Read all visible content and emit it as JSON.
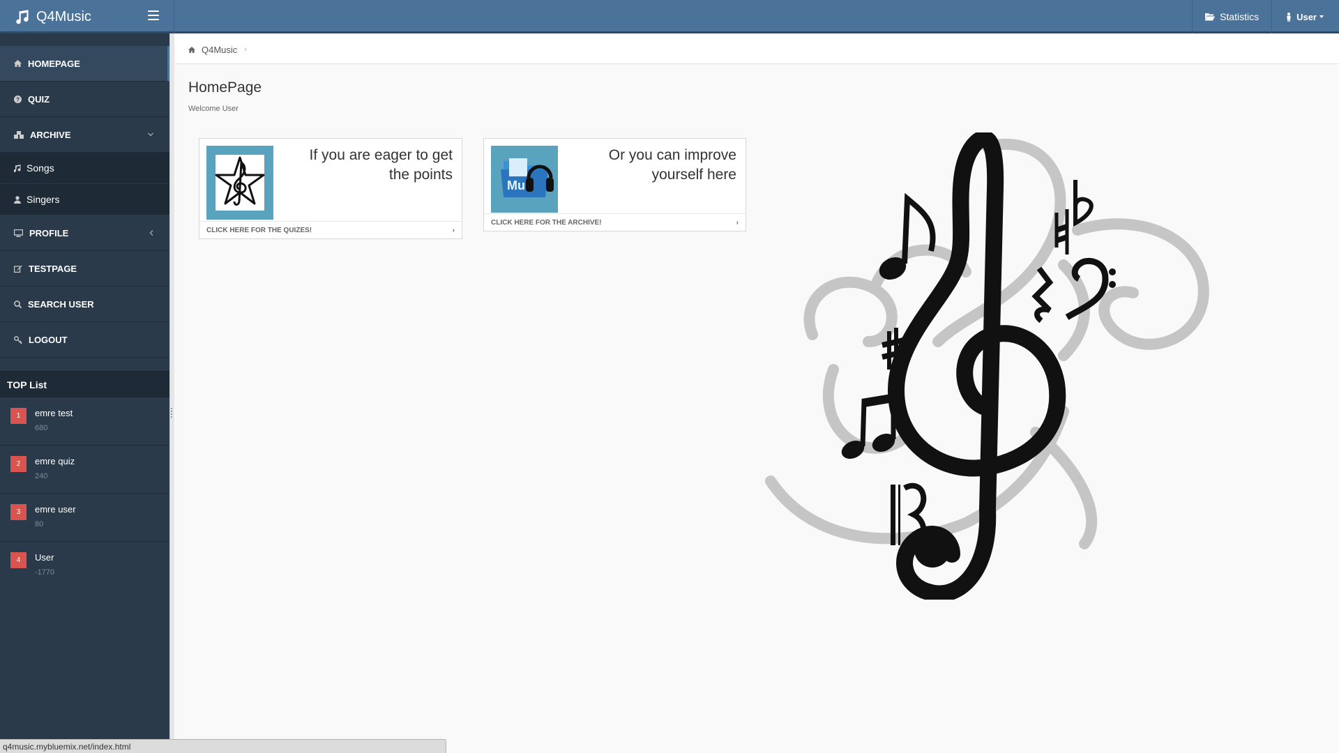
{
  "app": {
    "title": "Q4Music"
  },
  "header": {
    "statistics_label": "Statistics",
    "user_label": "User"
  },
  "sidebar": {
    "items": [
      {
        "label": "HOMEPAGE",
        "icon": "home-icon"
      },
      {
        "label": "QUIZ",
        "icon": "question-icon"
      },
      {
        "label": "ARCHIVE",
        "icon": "archive-icon"
      },
      {
        "label": "PROFILE",
        "icon": "monitor-icon"
      },
      {
        "label": "TESTPAGE",
        "icon": "edit-icon"
      },
      {
        "label": "SEARCH USER",
        "icon": "search-icon"
      },
      {
        "label": "LOGOUT",
        "icon": "key-icon"
      }
    ],
    "archive_sub": [
      {
        "label": "Songs",
        "icon": "music-icon"
      },
      {
        "label": "Singers",
        "icon": "user-icon"
      }
    ],
    "top_list": {
      "title": "TOP List",
      "entries": [
        {
          "rank": "1",
          "name": "emre test",
          "score": "680"
        },
        {
          "rank": "2",
          "name": "emre quiz",
          "score": "240"
        },
        {
          "rank": "3",
          "name": "emre user",
          "score": "80"
        },
        {
          "rank": "4",
          "name": "User",
          "score": "-1770"
        }
      ]
    }
  },
  "breadcrumb": {
    "home": "Q4Music"
  },
  "main": {
    "title": "HomePage",
    "subtitle": "Welcome User",
    "cards": [
      {
        "text_line1": "If you are eager to get",
        "text_line2": "the points",
        "footer": "CLICK HERE FOR THE QUIZES!"
      },
      {
        "text_line1": "Or you can improve",
        "text_line2": "yourself here",
        "footer": "CLICK HERE FOR THE ARCHIVE!"
      }
    ]
  },
  "status_bar": {
    "url": "q4music.mybluemix.net/index.html"
  },
  "colors": {
    "navbar": "#4b7399",
    "sidebar": "#2a3a4a",
    "rank_badge": "#d9534f",
    "card_image_bg": "#5aa3bf"
  }
}
